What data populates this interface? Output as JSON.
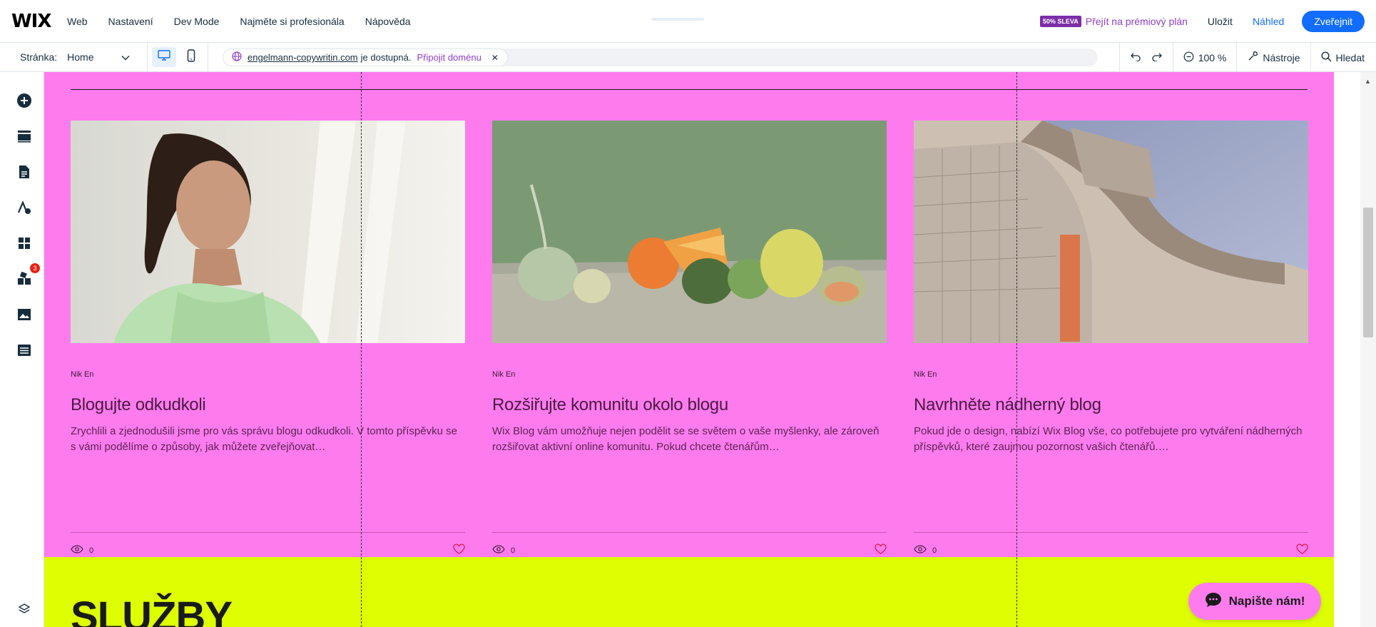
{
  "app": {
    "logo": "WIX"
  },
  "topnav": {
    "items": [
      "Web",
      "Nastavení",
      "Dev Mode",
      "Najměte si profesionála",
      "Nápověda"
    ]
  },
  "topright": {
    "badge": "50% SLEVA",
    "premium": "Přejít na prémiový plán",
    "save": "Uložit",
    "preview": "Náhled",
    "publish": "Zveřejnit"
  },
  "toolbar": {
    "page_label": "Stránka:",
    "page_value": "Home",
    "domain": "engelmann-copywritin.com",
    "domain_status": "je dostupná.",
    "connect": "Připojit doménu",
    "zoom": "100 %",
    "tools": "Nástroje",
    "search": "Hledat"
  },
  "leftbar": {
    "badge_count": "3"
  },
  "cards": [
    {
      "author": "Nik En",
      "title": "Blogujte odkudkoli",
      "excerpt": "Zrychlili a zjednodušili jsme pro vás správu blogu odkudkoli. V tomto příspěvku se s vámi podělíme o způsoby, jak můžete zveřejňovat…",
      "views": "0"
    },
    {
      "author": "Nik En",
      "title": "Rozšiřujte komunitu okolo blogu",
      "excerpt": "Wix Blog vám umožňuje nejen podělit se se světem o vaše myšlenky, ale zároveň rozšiřovat aktivní online komunitu. Pokud chcete čtenářům…",
      "views": "0"
    },
    {
      "author": "Nik En",
      "title": "Navrhněte nádherný blog",
      "excerpt": "Pokud jde o design, nabízí Wix Blog vše, co potřebujete pro vytváření nádherných příspěvků, které zaujmou pozornost vašich čtenářů.…",
      "views": "0"
    }
  ],
  "section": {
    "heading": "SLUŽBY"
  },
  "chat": {
    "label": "Napište nám!"
  },
  "colors": {
    "accent": "#116dff",
    "premium": "#8c3fc5",
    "pink_section": "#fe7bee",
    "lime_section": "#ddff00"
  }
}
